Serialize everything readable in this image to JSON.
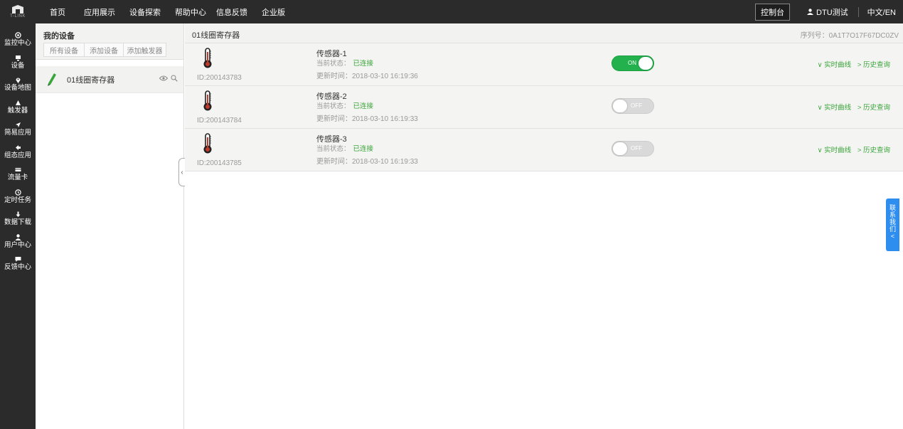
{
  "header": {
    "logo_text": "T-LINK",
    "nav": [
      "首页",
      "应用展示",
      "设备探索",
      "帮助中心",
      "信息反馈",
      "企业版"
    ],
    "console": "控制台",
    "user": "DTU测试",
    "lang": "中文/EN"
  },
  "sidebar": {
    "items": [
      {
        "label": "监控中心",
        "icon": "monitor-icon"
      },
      {
        "label": "设备",
        "icon": "device-icon"
      },
      {
        "label": "设备地图",
        "icon": "map-pin-icon"
      },
      {
        "label": "触发器",
        "icon": "trigger-icon"
      },
      {
        "label": "简易应用",
        "icon": "send-icon"
      },
      {
        "label": "组态应用",
        "icon": "arrow-left-icon"
      },
      {
        "label": "流量卡",
        "icon": "card-icon"
      },
      {
        "label": "定时任务",
        "icon": "clock-icon"
      },
      {
        "label": "数据下载",
        "icon": "download-icon"
      },
      {
        "label": "用户中心",
        "icon": "user-icon"
      },
      {
        "label": "反馈中心",
        "icon": "chat-icon"
      }
    ]
  },
  "devices": {
    "title": "我的设备",
    "tabs": [
      "所有设备",
      "添加设备",
      "添加触发器"
    ],
    "list": [
      {
        "name": "01线圈寄存器"
      }
    ]
  },
  "main": {
    "title": "01线圈寄存器",
    "serial": "序列号：0A1T7O17F67DC0ZV",
    "sensors": [
      {
        "name": "传感器-1",
        "status_label": "当前状态：",
        "status": "已连接",
        "time": "更新时间：2018-03-10 16:19:36",
        "id": "ID:200143783",
        "switch": "ON",
        "switch_on": true
      },
      {
        "name": "传感器-2",
        "status_label": "当前状态：",
        "status": "已连接",
        "time": "更新时间：2018-03-10 16:19:33",
        "id": "ID:200143784",
        "switch": "OFF",
        "switch_on": false
      },
      {
        "name": "传感器-3",
        "status_label": "当前状态：",
        "status": "已连接",
        "time": "更新时间：2018-03-10 16:19:33",
        "id": "ID:200143785",
        "switch": "OFF",
        "switch_on": false
      }
    ],
    "link_realtime": "∨ 实时曲线",
    "link_history": "> 历史查询"
  },
  "contact": [
    "联",
    "系",
    "我",
    "们",
    "<"
  ],
  "colors": {
    "accent_green": "#22b14c",
    "dark_bg": "#2b2b2b",
    "contact_blue": "#2e8ef0"
  }
}
